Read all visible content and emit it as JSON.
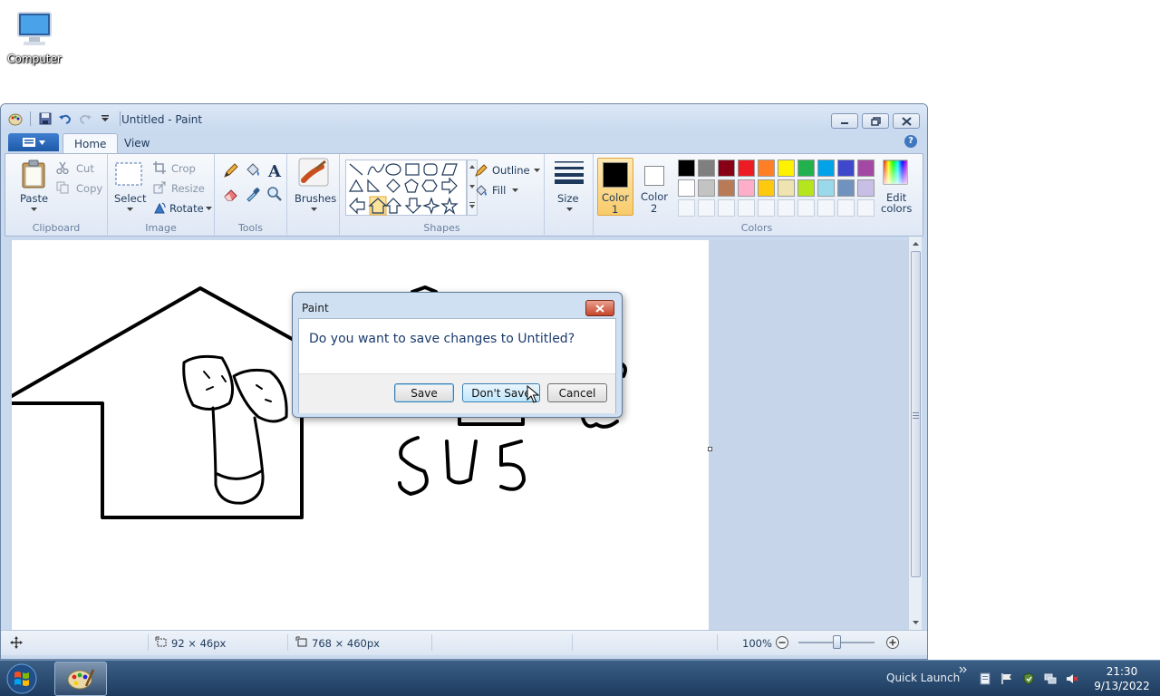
{
  "desktop": {
    "computer_label": "Computer"
  },
  "window": {
    "title": "Untitled - Paint"
  },
  "tabs": [
    "Home",
    "View"
  ],
  "ribbon": {
    "clipboard": {
      "paste": "Paste",
      "cut": "Cut",
      "copy": "Copy",
      "group": "Clipboard"
    },
    "image": {
      "select": "Select",
      "crop": "Crop",
      "resize": "Resize",
      "rotate": "Rotate",
      "group": "Image"
    },
    "tools": {
      "group": "Tools"
    },
    "brushes": {
      "label": "Brushes"
    },
    "shapes": {
      "outline": "Outline",
      "fill": "Fill",
      "group": "Shapes"
    },
    "size": {
      "label": "Size"
    },
    "colors": {
      "color1": "Color",
      "color1_num": "1",
      "color2": "Color",
      "color2_num": "2",
      "edit1": "Edit",
      "edit2": "colors",
      "group": "Colors",
      "palette_row1": [
        "#000000",
        "#7f7f7f",
        "#880015",
        "#ed1c24",
        "#ff7f27",
        "#fff200",
        "#22b14c",
        "#00a2e8",
        "#3f48cc",
        "#a349a4"
      ],
      "palette_row2": [
        "#ffffff",
        "#c3c3c3",
        "#b97a57",
        "#ffaec9",
        "#ffc90e",
        "#efe4b0",
        "#b5e61d",
        "#99d9ea",
        "#7092be",
        "#c8bfe7"
      ]
    }
  },
  "canvas": {
    "drawn_text": "SUS"
  },
  "status": {
    "selection_size": "92 × 46px",
    "canvas_size": "768 × 460px",
    "zoom": "100%"
  },
  "dialog": {
    "title": "Paint",
    "message": "Do you want to save changes to Untitled?",
    "save": "Save",
    "dont_save": "Don't Save",
    "cancel": "Cancel"
  },
  "taskbar": {
    "quick_launch": "Quick Launch",
    "time": "21:30",
    "date": "9/13/2022"
  }
}
